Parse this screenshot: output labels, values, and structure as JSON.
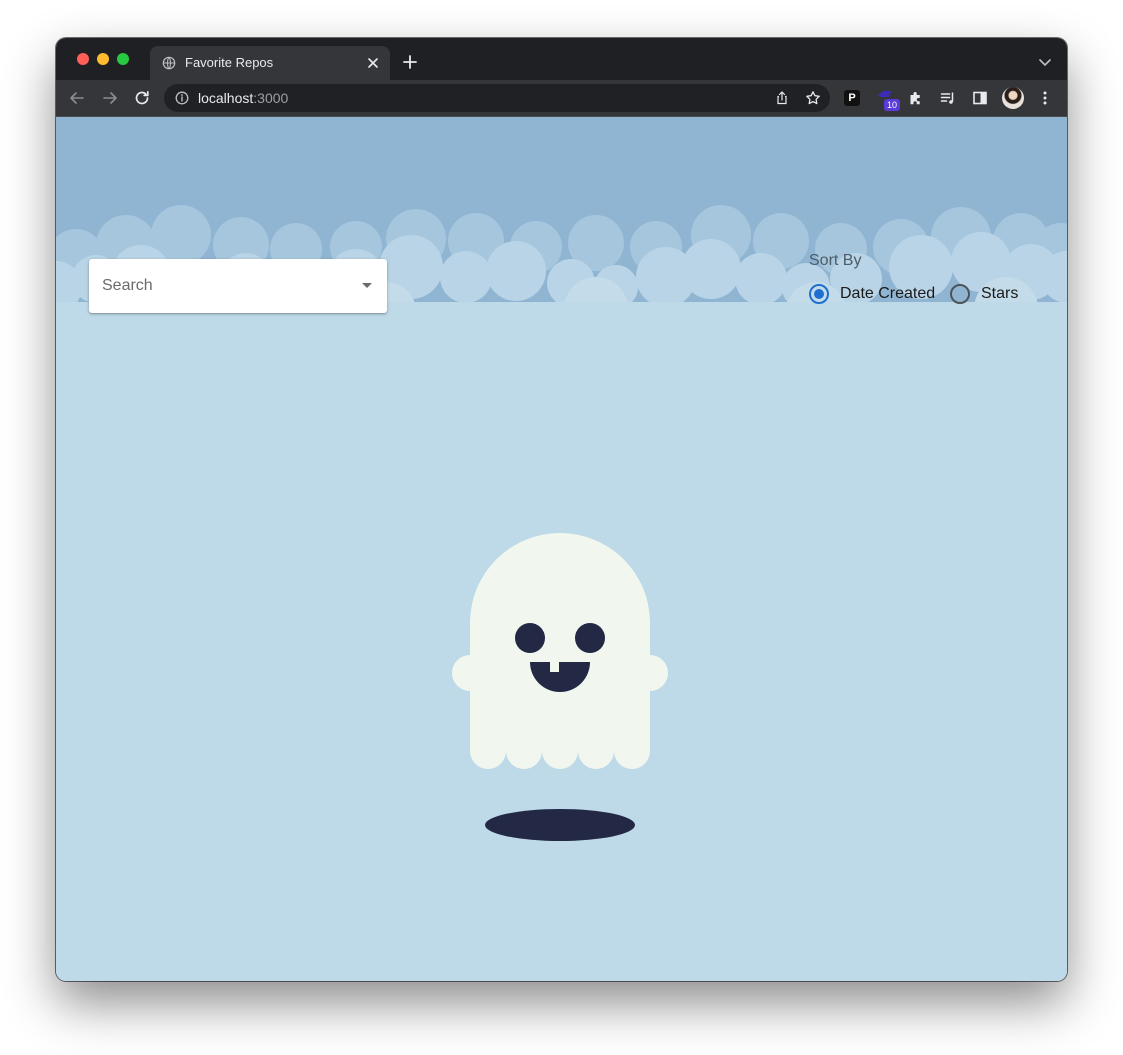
{
  "browser": {
    "tab_title": "Favorite Repos",
    "url_host": "localhost",
    "url_port": ":3000",
    "extension_p_label": "P",
    "extension_badge_count": "10"
  },
  "search": {
    "placeholder": "Search"
  },
  "sort": {
    "label": "Sort By",
    "options": [
      {
        "label": "Date Created",
        "checked": true
      },
      {
        "label": "Stars",
        "checked": false
      }
    ]
  },
  "colors": {
    "sky": "#8fb5d2",
    "background": "#bed9e8",
    "clouds": "#c4dcea",
    "ghost_body": "#f1f7ef",
    "ghost_face": "#232845",
    "radio_accent": "#1f6fd1"
  },
  "icons": {
    "favicon": "globe-icon",
    "tab_close": "close-icon",
    "new_tab": "plus-icon",
    "back": "arrow-left-icon",
    "forward": "arrow-right-icon",
    "reload": "reload-icon",
    "info": "info-icon",
    "share": "share-icon",
    "bookmark": "star-icon",
    "extensions": "puzzle-icon",
    "reading_list": "reading-list-icon",
    "side_panel": "side-panel-icon",
    "menu": "kebab-menu-icon"
  }
}
